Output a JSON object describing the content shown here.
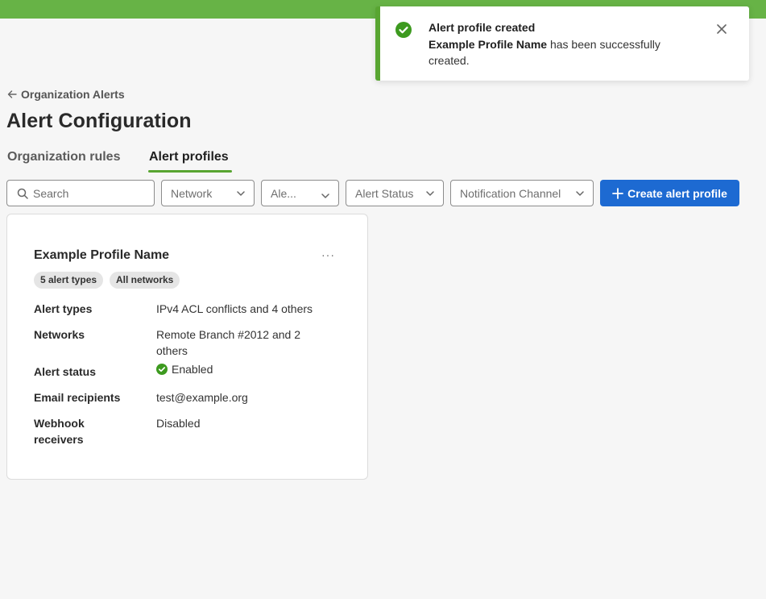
{
  "toast": {
    "title": "Alert profile created",
    "profile_name": "Example Profile Name",
    "message": " has been successfully created.",
    "accent_color": "#58a531",
    "icon": "check-circle-icon",
    "close_icon": "close-icon"
  },
  "nav": {
    "back_label": "Organization Alerts"
  },
  "page": {
    "title": "Alert Configuration"
  },
  "tabs": [
    {
      "label": "Organization rules",
      "active": false
    },
    {
      "label": "Alert profiles",
      "active": true
    }
  ],
  "filters": {
    "search_placeholder": "Search",
    "network": "Network",
    "alert_type": "Ale...",
    "alert_status": "Alert Status",
    "notification_channel": "Notification Channel"
  },
  "create_button": {
    "label": "Create alert profile",
    "color": "#1d6ad2"
  },
  "profile_card": {
    "name": "Example Profile Name",
    "menu": "···",
    "badges": [
      "5 alert types",
      "All networks"
    ],
    "rows": [
      {
        "label": "Alert types",
        "value": "IPv4 ACL conflicts and 4 others"
      },
      {
        "label": "Networks",
        "value": "Remote Branch #2012 and 2 others"
      },
      {
        "label": "Alert status",
        "value": "Enabled"
      },
      {
        "label": "Email recipients",
        "value": "test@example.org"
      },
      {
        "label": "Webhook receivers",
        "value": "Disabled"
      }
    ]
  }
}
